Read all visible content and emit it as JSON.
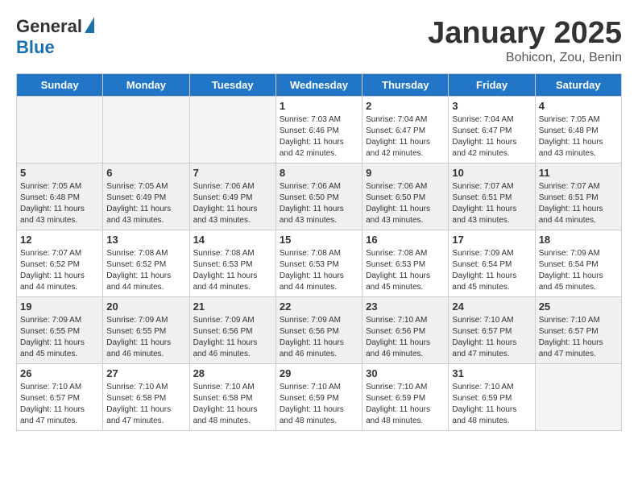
{
  "header": {
    "logo_general": "General",
    "logo_blue": "Blue",
    "title": "January 2025",
    "subtitle": "Bohicon, Zou, Benin"
  },
  "weekdays": [
    "Sunday",
    "Monday",
    "Tuesday",
    "Wednesday",
    "Thursday",
    "Friday",
    "Saturday"
  ],
  "weeks": [
    [
      {
        "day": "",
        "info": ""
      },
      {
        "day": "",
        "info": ""
      },
      {
        "day": "",
        "info": ""
      },
      {
        "day": "1",
        "info": "Sunrise: 7:03 AM\nSunset: 6:46 PM\nDaylight: 11 hours and 42 minutes."
      },
      {
        "day": "2",
        "info": "Sunrise: 7:04 AM\nSunset: 6:47 PM\nDaylight: 11 hours and 42 minutes."
      },
      {
        "day": "3",
        "info": "Sunrise: 7:04 AM\nSunset: 6:47 PM\nDaylight: 11 hours and 42 minutes."
      },
      {
        "day": "4",
        "info": "Sunrise: 7:05 AM\nSunset: 6:48 PM\nDaylight: 11 hours and 43 minutes."
      }
    ],
    [
      {
        "day": "5",
        "info": "Sunrise: 7:05 AM\nSunset: 6:48 PM\nDaylight: 11 hours and 43 minutes."
      },
      {
        "day": "6",
        "info": "Sunrise: 7:05 AM\nSunset: 6:49 PM\nDaylight: 11 hours and 43 minutes."
      },
      {
        "day": "7",
        "info": "Sunrise: 7:06 AM\nSunset: 6:49 PM\nDaylight: 11 hours and 43 minutes."
      },
      {
        "day": "8",
        "info": "Sunrise: 7:06 AM\nSunset: 6:50 PM\nDaylight: 11 hours and 43 minutes."
      },
      {
        "day": "9",
        "info": "Sunrise: 7:06 AM\nSunset: 6:50 PM\nDaylight: 11 hours and 43 minutes."
      },
      {
        "day": "10",
        "info": "Sunrise: 7:07 AM\nSunset: 6:51 PM\nDaylight: 11 hours and 43 minutes."
      },
      {
        "day": "11",
        "info": "Sunrise: 7:07 AM\nSunset: 6:51 PM\nDaylight: 11 hours and 44 minutes."
      }
    ],
    [
      {
        "day": "12",
        "info": "Sunrise: 7:07 AM\nSunset: 6:52 PM\nDaylight: 11 hours and 44 minutes."
      },
      {
        "day": "13",
        "info": "Sunrise: 7:08 AM\nSunset: 6:52 PM\nDaylight: 11 hours and 44 minutes."
      },
      {
        "day": "14",
        "info": "Sunrise: 7:08 AM\nSunset: 6:53 PM\nDaylight: 11 hours and 44 minutes."
      },
      {
        "day": "15",
        "info": "Sunrise: 7:08 AM\nSunset: 6:53 PM\nDaylight: 11 hours and 44 minutes."
      },
      {
        "day": "16",
        "info": "Sunrise: 7:08 AM\nSunset: 6:53 PM\nDaylight: 11 hours and 45 minutes."
      },
      {
        "day": "17",
        "info": "Sunrise: 7:09 AM\nSunset: 6:54 PM\nDaylight: 11 hours and 45 minutes."
      },
      {
        "day": "18",
        "info": "Sunrise: 7:09 AM\nSunset: 6:54 PM\nDaylight: 11 hours and 45 minutes."
      }
    ],
    [
      {
        "day": "19",
        "info": "Sunrise: 7:09 AM\nSunset: 6:55 PM\nDaylight: 11 hours and 45 minutes."
      },
      {
        "day": "20",
        "info": "Sunrise: 7:09 AM\nSunset: 6:55 PM\nDaylight: 11 hours and 46 minutes."
      },
      {
        "day": "21",
        "info": "Sunrise: 7:09 AM\nSunset: 6:56 PM\nDaylight: 11 hours and 46 minutes."
      },
      {
        "day": "22",
        "info": "Sunrise: 7:09 AM\nSunset: 6:56 PM\nDaylight: 11 hours and 46 minutes."
      },
      {
        "day": "23",
        "info": "Sunrise: 7:10 AM\nSunset: 6:56 PM\nDaylight: 11 hours and 46 minutes."
      },
      {
        "day": "24",
        "info": "Sunrise: 7:10 AM\nSunset: 6:57 PM\nDaylight: 11 hours and 47 minutes."
      },
      {
        "day": "25",
        "info": "Sunrise: 7:10 AM\nSunset: 6:57 PM\nDaylight: 11 hours and 47 minutes."
      }
    ],
    [
      {
        "day": "26",
        "info": "Sunrise: 7:10 AM\nSunset: 6:57 PM\nDaylight: 11 hours and 47 minutes."
      },
      {
        "day": "27",
        "info": "Sunrise: 7:10 AM\nSunset: 6:58 PM\nDaylight: 11 hours and 47 minutes."
      },
      {
        "day": "28",
        "info": "Sunrise: 7:10 AM\nSunset: 6:58 PM\nDaylight: 11 hours and 48 minutes."
      },
      {
        "day": "29",
        "info": "Sunrise: 7:10 AM\nSunset: 6:59 PM\nDaylight: 11 hours and 48 minutes."
      },
      {
        "day": "30",
        "info": "Sunrise: 7:10 AM\nSunset: 6:59 PM\nDaylight: 11 hours and 48 minutes."
      },
      {
        "day": "31",
        "info": "Sunrise: 7:10 AM\nSunset: 6:59 PM\nDaylight: 11 hours and 48 minutes."
      },
      {
        "day": "",
        "info": ""
      }
    ]
  ]
}
